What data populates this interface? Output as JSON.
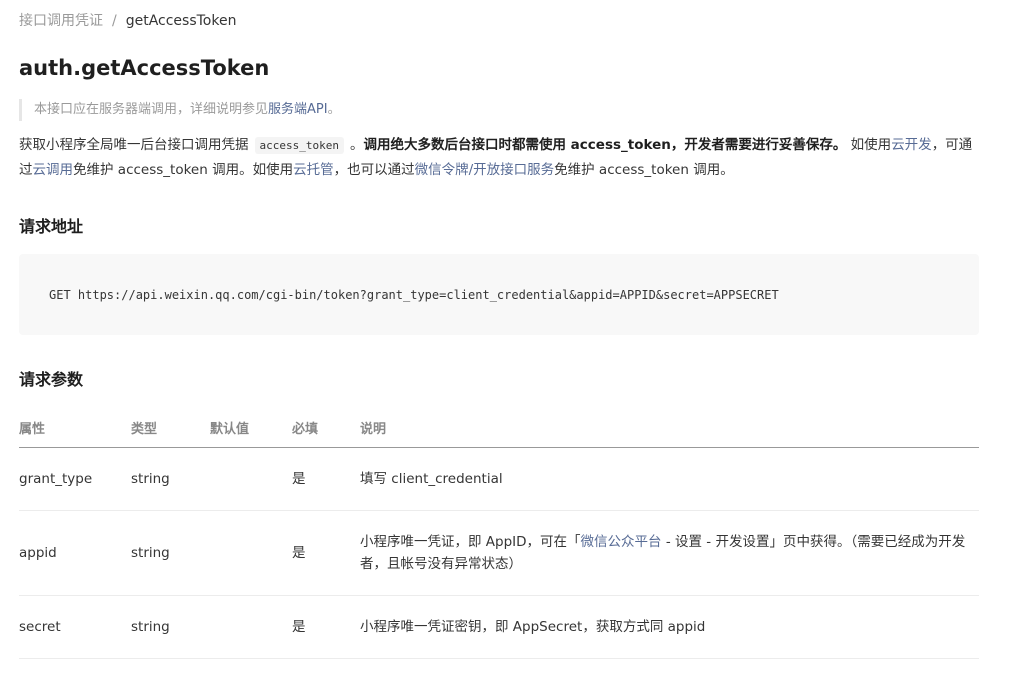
{
  "breadcrumb": {
    "parent": "接口调用凭证",
    "separator": "/",
    "current": "getAccessToken"
  },
  "page_title": "auth.getAccessToken",
  "note": {
    "before": "本接口应在服务器端调用，详细说明参见",
    "link": "服务端API",
    "after": "。"
  },
  "intro": {
    "t1": "获取小程序全局唯一后台接口调用凭据",
    "code": "access_token",
    "t2": "。",
    "bold": "调用绝大多数后台接口时都需使用 access_token，开发者需要进行妥善保存。",
    "t3": " 如使用",
    "link_cloud_dev": "云开发",
    "t4": "，可通过",
    "link_cloud_call": "云调用",
    "t5": "免维护 access_token 调用。如使用",
    "link_cloud_host": "云托管",
    "t6": "，也可以通过",
    "link_token_service": "微信令牌/开放接口服务",
    "t7": "免维护 access_token 调用。"
  },
  "request_url": {
    "heading": "请求地址",
    "value": "GET https://api.weixin.qq.com/cgi-bin/token?grant_type=client_credential&appid=APPID&secret=APPSECRET"
  },
  "request_params": {
    "heading": "请求参数",
    "columns": [
      "属性",
      "类型",
      "默认值",
      "必填",
      "说明"
    ],
    "rows": [
      {
        "name": "grant_type",
        "type": "string",
        "default": "",
        "required": "是",
        "desc": "填写 client_credential"
      },
      {
        "name": "appid",
        "type": "string",
        "default": "",
        "required": "是",
        "desc_before": "小程序唯一凭证，即 AppID，可在「",
        "desc_link": "微信公众平台",
        "desc_after": " - 设置 - 开发设置」页中获得。（需要已经成为开发者，且帐号没有异常状态）"
      },
      {
        "name": "secret",
        "type": "string",
        "default": "",
        "required": "是",
        "desc": "小程序唯一凭证密钥，即 AppSecret，获取方式同 appid"
      }
    ]
  },
  "colors": {
    "link": "#576b95",
    "text": "#353535",
    "muted": "#9a9a9a",
    "code_bg": "#f8f8f8"
  }
}
